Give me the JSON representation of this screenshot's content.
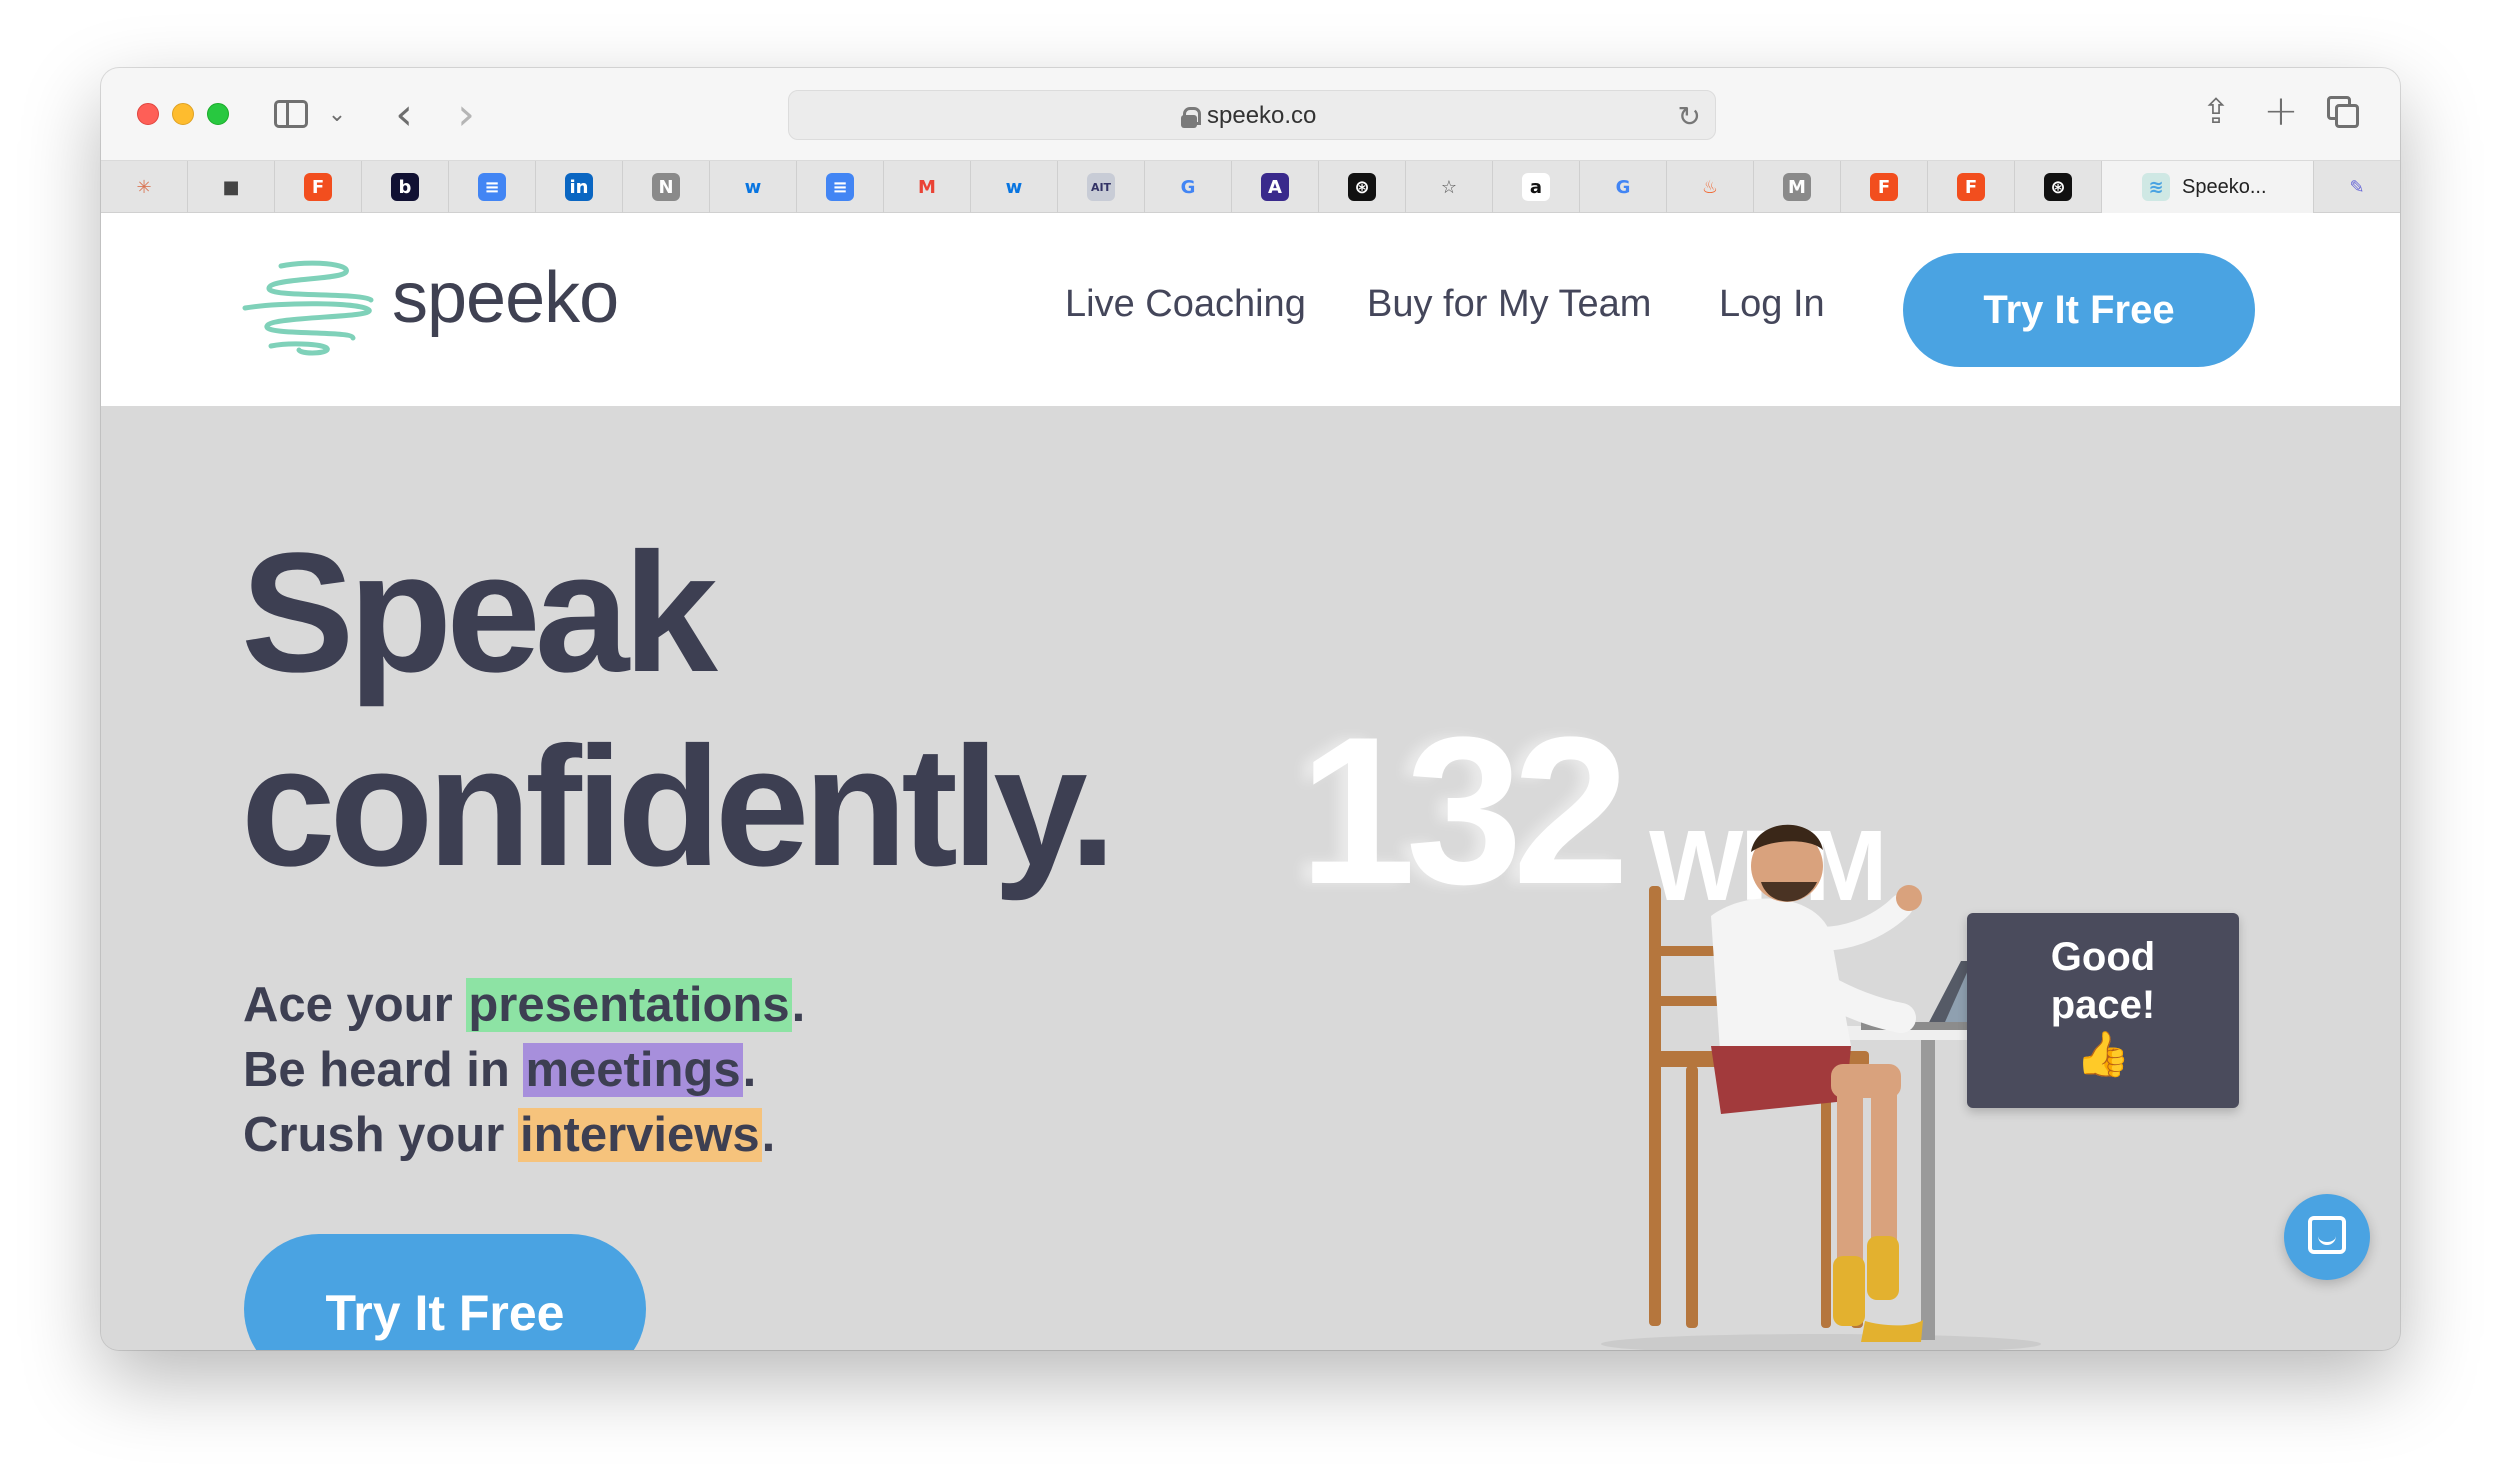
{
  "browser": {
    "url": "speeko.co",
    "active_tab_title": "Speeko..."
  },
  "favorites": [
    {
      "icon": "claude-icon",
      "glyph": "✳",
      "bg": "transparent",
      "fg": "#d97757"
    },
    {
      "icon": "box-icon",
      "glyph": "■",
      "bg": "transparent",
      "fg": "#444444"
    },
    {
      "icon": "figma-icon",
      "glyph": "F",
      "bg": "#f24e1e",
      "fg": "#ffffff"
    },
    {
      "icon": "b-icon",
      "glyph": "b",
      "bg": "#111133",
      "fg": "#ffffff"
    },
    {
      "icon": "google-docs-icon",
      "glyph": "≡",
      "bg": "#4285f4",
      "fg": "#ffffff"
    },
    {
      "icon": "linkedin-icon",
      "glyph": "in",
      "bg": "#0a66c2",
      "fg": "#ffffff"
    },
    {
      "icon": "notion-icon",
      "glyph": "N",
      "bg": "#8a8a8a",
      "fg": "#ffffff"
    },
    {
      "icon": "workday-icon",
      "glyph": "w",
      "bg": "transparent",
      "fg": "#0875e1"
    },
    {
      "icon": "google-docs-icon",
      "glyph": "≡",
      "bg": "#4285f4",
      "fg": "#ffffff"
    },
    {
      "icon": "gmail-icon",
      "glyph": "M",
      "bg": "transparent",
      "fg": "#ea4335"
    },
    {
      "icon": "workday-icon",
      "glyph": "w",
      "bg": "transparent",
      "fg": "#0875e1"
    },
    {
      "icon": "ait-icon",
      "glyph": "AIT",
      "bg": "#c8ccd6",
      "fg": "#333366"
    },
    {
      "icon": "google-icon",
      "glyph": "G",
      "bg": "transparent",
      "fg": "#4285f4"
    },
    {
      "icon": "a-icon",
      "glyph": "A",
      "bg": "#3a2a8c",
      "fg": "#ffffff"
    },
    {
      "icon": "openai-icon",
      "glyph": "⊛",
      "bg": "#111111",
      "fg": "#ffffff"
    },
    {
      "icon": "star-icon",
      "glyph": "☆",
      "bg": "transparent",
      "fg": "#555555"
    },
    {
      "icon": "amazon-icon",
      "glyph": "a",
      "bg": "#ffffff",
      "fg": "#111111"
    },
    {
      "icon": "google-icon",
      "glyph": "G",
      "bg": "transparent",
      "fg": "#4285f4"
    },
    {
      "icon": "flame-icon",
      "glyph": "♨",
      "bg": "transparent",
      "fg": "#f06a35"
    },
    {
      "icon": "m-icon",
      "glyph": "M",
      "bg": "#8a8a8a",
      "fg": "#ffffff"
    },
    {
      "icon": "figma-icon",
      "glyph": "F",
      "bg": "#f24e1e",
      "fg": "#ffffff"
    },
    {
      "icon": "figma-icon",
      "glyph": "F",
      "bg": "#f24e1e",
      "fg": "#ffffff"
    },
    {
      "icon": "openai-icon",
      "glyph": "⊛",
      "bg": "#111111",
      "fg": "#ffffff"
    }
  ],
  "site": {
    "logo_text": "speeko",
    "nav": {
      "live_coaching": "Live Coaching",
      "buy_team": "Buy for My Team",
      "login": "Log In"
    },
    "cta_label": "Try It Free",
    "brand_color": "#4aa3e2"
  },
  "hero": {
    "headline_line1": "Speak",
    "headline_line2": "confidently.",
    "tagline": [
      {
        "prefix": "Ace your ",
        "highlight": "presentations",
        "suffix": "."
      },
      {
        "prefix": "Be heard in ",
        "highlight": "meetings",
        "suffix": "."
      },
      {
        "prefix": "Crush your ",
        "highlight": "interviews",
        "suffix": "."
      }
    ],
    "cta_label": "Try It Free",
    "wpm_value": "132",
    "wpm_unit": "WPM",
    "pace_line1": "Good",
    "pace_line2": "pace!",
    "pace_icon": "thumbs-up-icon"
  }
}
